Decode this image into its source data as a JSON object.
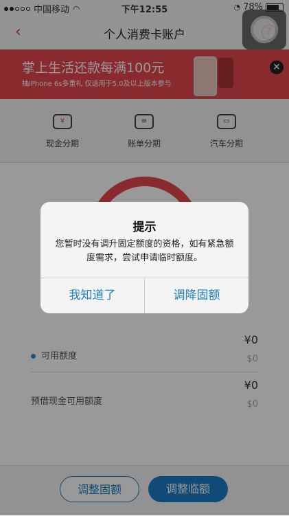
{
  "status_bar": {
    "carrier": "中国移动",
    "time": "下午12:55",
    "battery": "78%"
  },
  "nav": {
    "back_glyph": "‹",
    "title": "个人消费卡账户",
    "help_glyph": "?"
  },
  "banner": {
    "headline": "掌上生活还款每满100元",
    "subline": "抽iPhone 6s多重礼 仅适用于5.0及以上版本参与",
    "close_glyph": "✕"
  },
  "menu": [
    {
      "label": "现金分期",
      "icon": "¥"
    },
    {
      "label": "账单分期",
      "icon": "≡"
    },
    {
      "label": "汽车分期",
      "icon": "▭"
    }
  ],
  "limits": {
    "available_label": "可用额度",
    "available_value": "¥0",
    "available_sub": "$0",
    "cash_label": "预借现金可用额度",
    "cash_value": "¥0",
    "cash_sub": "$0"
  },
  "bottom": {
    "adjust_fixed": "调整固额",
    "adjust_temp": "调整临额"
  },
  "dialog": {
    "title": "提示",
    "message": "您暂时没有调升固定额度的资格，如有紧急额度需求，尝试申请临时额度。",
    "ok": "我知道了",
    "lower": "调降固额"
  },
  "colors": {
    "accent": "#1a7ec5",
    "brand_red": "#e4484d"
  }
}
